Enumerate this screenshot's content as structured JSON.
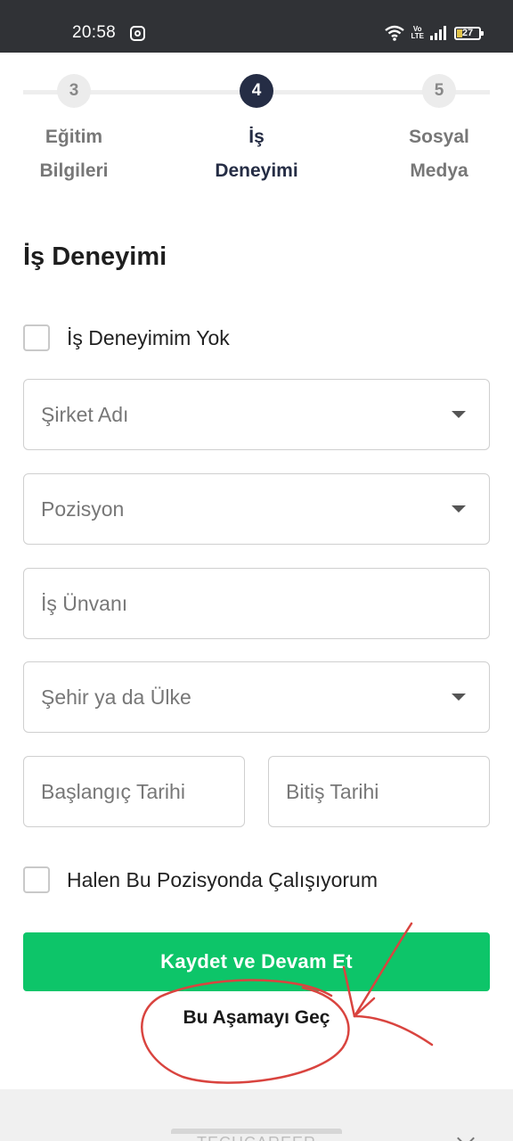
{
  "status_bar": {
    "time": "20:58",
    "network_label": "Vo\nLTE",
    "battery_level": "27"
  },
  "stepper": {
    "current_step": 4,
    "steps": [
      {
        "number": "3",
        "label_line1": "Eğitim",
        "label_line2": "Bilgileri"
      },
      {
        "number": "4",
        "label_line1": "İş",
        "label_line2": "Deneyimi"
      },
      {
        "number": "5",
        "label_line1": "Sosyal",
        "label_line2": "Medya"
      }
    ]
  },
  "form": {
    "title": "İş Deneyimi",
    "no_experience_label": "İş Deneyimim Yok",
    "company_placeholder": "Şirket Adı",
    "position_placeholder": "Pozisyon",
    "job_title_placeholder": "İş Ünvanı",
    "city_country_placeholder": "Şehir ya da Ülke",
    "start_date_placeholder": "Başlangıç Tarihi",
    "end_date_placeholder": "Bitiş Tarihi",
    "currently_working_label": "Halen Bu Pozisyonda Çalışıyorum",
    "save_continue_label": "Kaydet ve Devam Et",
    "skip_label": "Bu Aşamayı Geç"
  },
  "footer": {
    "brand_text": "TECHCAREER"
  },
  "colors": {
    "primary_green": "#0dc569",
    "active_step": "#252d45",
    "annotation_red": "#d9443f",
    "status_bar": "#303236"
  }
}
